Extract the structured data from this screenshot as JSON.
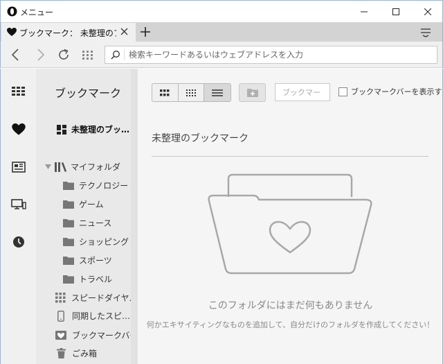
{
  "window": {
    "title": "メニュー",
    "minimize_icon": "minimize-icon",
    "maximize_icon": "maximize-icon",
    "close_icon": "close-icon"
  },
  "tab": {
    "title": "ブックマーク： 未整理のブックマーク",
    "favicon": "heart-icon",
    "close_icon": "close-icon"
  },
  "toolbar": {
    "back_icon": "back-arrow-icon",
    "forward_icon": "forward-arrow-icon",
    "reload_icon": "reload-icon",
    "speeddial_icon": "grid-icon",
    "address_placeholder": "検索キーワードあるいはウェブアドレスを入力"
  },
  "sidebar": {
    "icons": [
      "speed-dial-icon",
      "heart-icon",
      "news-icon",
      "devices-icon",
      "history-icon"
    ]
  },
  "bookmarks_panel": {
    "title": "ブックマーク",
    "items": [
      {
        "label": "未整理のブッ…",
        "icon": "unsorted-icon",
        "bold": true
      },
      {
        "label": "マイフォルダ",
        "icon": "library-icon",
        "expanded": true
      },
      {
        "label": "テクノロジー",
        "icon": "folder-icon"
      },
      {
        "label": "ゲーム",
        "icon": "folder-icon"
      },
      {
        "label": "ニュース",
        "icon": "folder-icon"
      },
      {
        "label": "ショッピング",
        "icon": "folder-icon"
      },
      {
        "label": "スポーツ",
        "icon": "folder-icon"
      },
      {
        "label": "トラベル",
        "icon": "folder-icon"
      },
      {
        "label": "スピードダイヤル",
        "icon": "grid-icon"
      },
      {
        "label": "同期したスピ…",
        "icon": "phone-icon"
      },
      {
        "label": "ブックマークバー",
        "icon": "heart-bar-icon"
      },
      {
        "label": "ごみ箱",
        "icon": "trash-icon"
      }
    ]
  },
  "main": {
    "search_placeholder": "ブックマー",
    "show_bar_label": "ブックマークバーを表示する",
    "show_bar_checked": false,
    "folder_heading": "未整理のブックマーク",
    "empty_title": "このフォルダにはまだ何もありません",
    "empty_subtitle": "何かエキサイティングなものを追加して、自分だけのフォルダを作成してください！"
  },
  "colors": {
    "titlebar_bg": "#ffffff",
    "tabbar_bg": "#d3d3d3",
    "active_tab_bg": "#f0f0f0",
    "sidebar_bg": "#f0f0f0",
    "panel_bg": "#e9e9e9",
    "main_bg": "#f5f5f5",
    "illustration_stroke": "#a8a8a8"
  }
}
